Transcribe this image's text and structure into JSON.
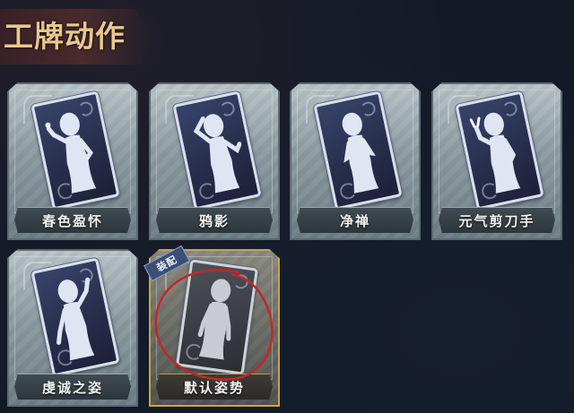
{
  "header": {
    "title": "工牌动作"
  },
  "cards": [
    {
      "label": "春色盈怀",
      "pose": "flower",
      "equipped": false
    },
    {
      "label": "鸦影",
      "pose": "crow",
      "equipped": false
    },
    {
      "label": "净禅",
      "pose": "zen",
      "equipped": false
    },
    {
      "label": "元气剪刀手",
      "pose": "peace",
      "equipped": false
    },
    {
      "label": "虔诚之姿",
      "pose": "pray",
      "equipped": false
    },
    {
      "label": "默认姿势",
      "pose": "default",
      "equipped": true,
      "badge": "装配"
    }
  ],
  "colors": {
    "background": "#121a26",
    "title": "#e7c98e",
    "equipped_border": "#c8a548",
    "annotation": "#c0282a"
  }
}
